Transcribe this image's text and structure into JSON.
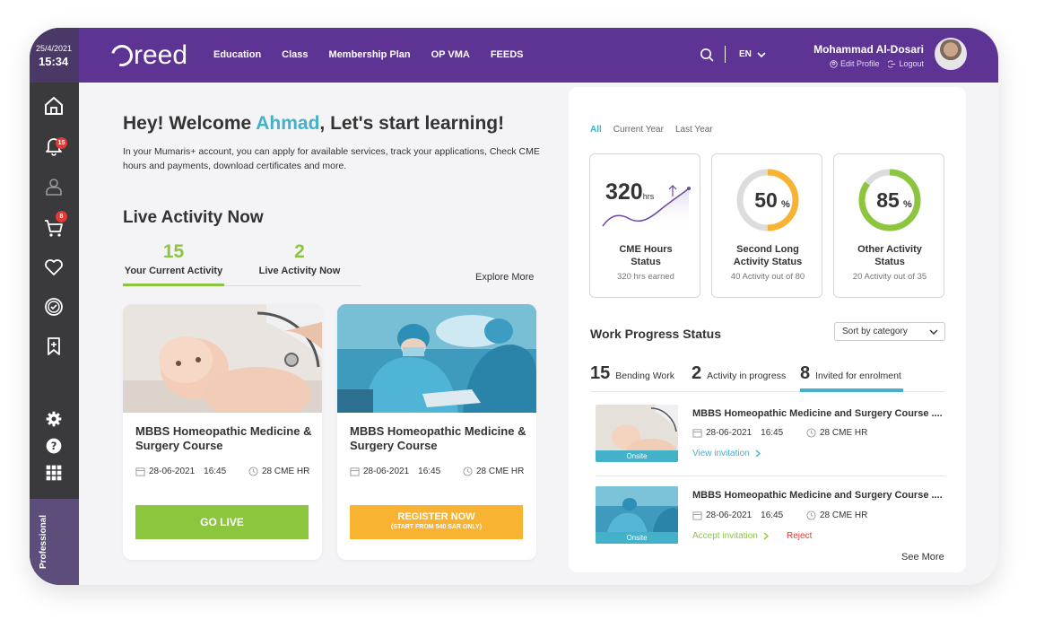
{
  "clock": {
    "date": "25/4/2021",
    "time": "15:34"
  },
  "brand": {
    "logo_text": "reed"
  },
  "nav": {
    "items": [
      "Education",
      "Class",
      "Membership Plan",
      "OP VMA",
      "FEEDS"
    ]
  },
  "header": {
    "language": "EN",
    "user_name": "Mohammad Al-Dosari",
    "edit_profile": "Edit Profile",
    "logout": "Logout"
  },
  "sidebar": {
    "notifications_badge": "15",
    "cart_badge": "8",
    "professional_label": "Professional"
  },
  "welcome": {
    "prefix": "Hey! Welcome ",
    "name": "Ahmad",
    "suffix": ", Let's start learning!",
    "intro": "In your Mumaris+ account, you can apply for available services, track your applications, Check CME hours and payments, download certificates and more."
  },
  "live": {
    "title": "Live Activity Now",
    "stats": [
      {
        "value": "15",
        "label": "Your Current Activity"
      },
      {
        "value": "2",
        "label": "Live Activity Now"
      }
    ],
    "explore_more": "Explore More",
    "cards": [
      {
        "title": "MBBS Homeopathic Medicine & Surgery Course",
        "date": "28-06-2021",
        "time": "16:45",
        "cme": "28 CME HR",
        "button": "GO LIVE",
        "button_sub": ""
      },
      {
        "title": "MBBS Homeopathic Medicine & Surgery Course",
        "date": "28-06-2021",
        "time": "16:45",
        "cme": "28 CME HR",
        "button": "REGISTER NOW",
        "button_sub": "(START FROM 540 SAR ONLY)"
      }
    ]
  },
  "filters": {
    "items": [
      "All",
      "Current Year",
      "Last Year"
    ],
    "active": "All"
  },
  "status_cards": [
    {
      "value": "320",
      "unit": "hrs",
      "title_line1": "CME Hours",
      "title_line2": "Status",
      "sub": "320 hrs earned"
    },
    {
      "value": "50",
      "unit": "%",
      "percent": 50,
      "color": "#f7b331",
      "title_line1": "Second Long",
      "title_line2": "Activity Status",
      "sub": "40 Activity out of 80"
    },
    {
      "value": "85",
      "unit": "%",
      "percent": 85,
      "color": "#8cc63f",
      "title_line1": "Other Activity",
      "title_line2": "Status",
      "sub": "20 Activity out of 35"
    }
  ],
  "work_progress": {
    "title": "Work Progress Status",
    "sort_label": "Sort by category",
    "tabs": [
      {
        "count": "15",
        "label": "Bending Work"
      },
      {
        "count": "2",
        "label": "Activity in progress"
      },
      {
        "count": "8",
        "label": "Invited for enrolment"
      }
    ],
    "items": [
      {
        "title": "MBBS Homeopathic Medicine and  Surgery Course ....",
        "date": "28-06-2021",
        "time": "16:45",
        "cme": "28 CME HR",
        "tag": "Onsite",
        "action": "View invitation"
      },
      {
        "title": "MBBS Homeopathic Medicine and  Surgery Course ....",
        "date": "28-06-2021",
        "time": "16:45",
        "cme": "28 CME HR",
        "tag": "Onsite",
        "action": "Accept invitation",
        "secondary_action": "Reject"
      }
    ],
    "see_more": "See More"
  },
  "colors": {
    "brand_purple": "#5d3494",
    "accent_teal": "#43b1c7",
    "accent_green": "#8cc63f",
    "accent_orange": "#f7b331",
    "badge_red": "#e53935"
  }
}
